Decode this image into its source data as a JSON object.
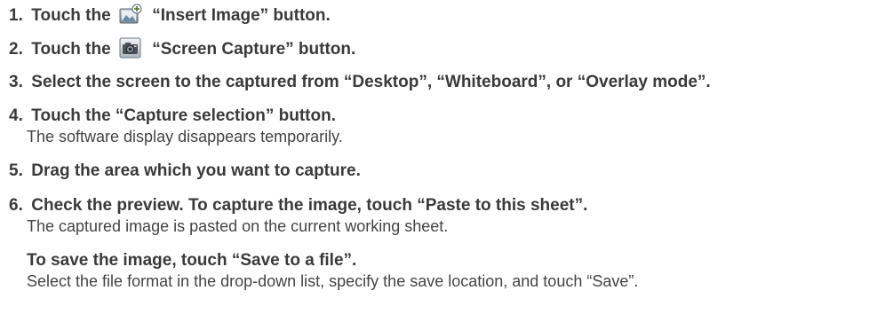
{
  "steps": [
    {
      "num": "1.",
      "pre": "Touch the",
      "icon": "insert-image-icon",
      "post": "“Insert Image” button."
    },
    {
      "num": "2.",
      "pre": "Touch the",
      "icon": "screen-capture-icon",
      "post": "“Screen Capture” button."
    },
    {
      "num": "3.",
      "text": "Select the screen to the captured from “Desktop”, “Whiteboard”, or “Overlay mode”."
    },
    {
      "num": "4.",
      "text": "Touch the “Capture selection” button.",
      "note": "The software display disappears temporarily."
    },
    {
      "num": "5.",
      "text": "Drag the area which you want to capture."
    },
    {
      "num": "6.",
      "text": "Check the preview. To capture the image, touch “Paste to this sheet”.",
      "note": "The captured image is pasted on the current working sheet."
    }
  ],
  "save": {
    "heading": "To save the image, touch “Save to a file”.",
    "note": "Select the file format in the drop-down list, specify the save location, and touch “Save”."
  }
}
